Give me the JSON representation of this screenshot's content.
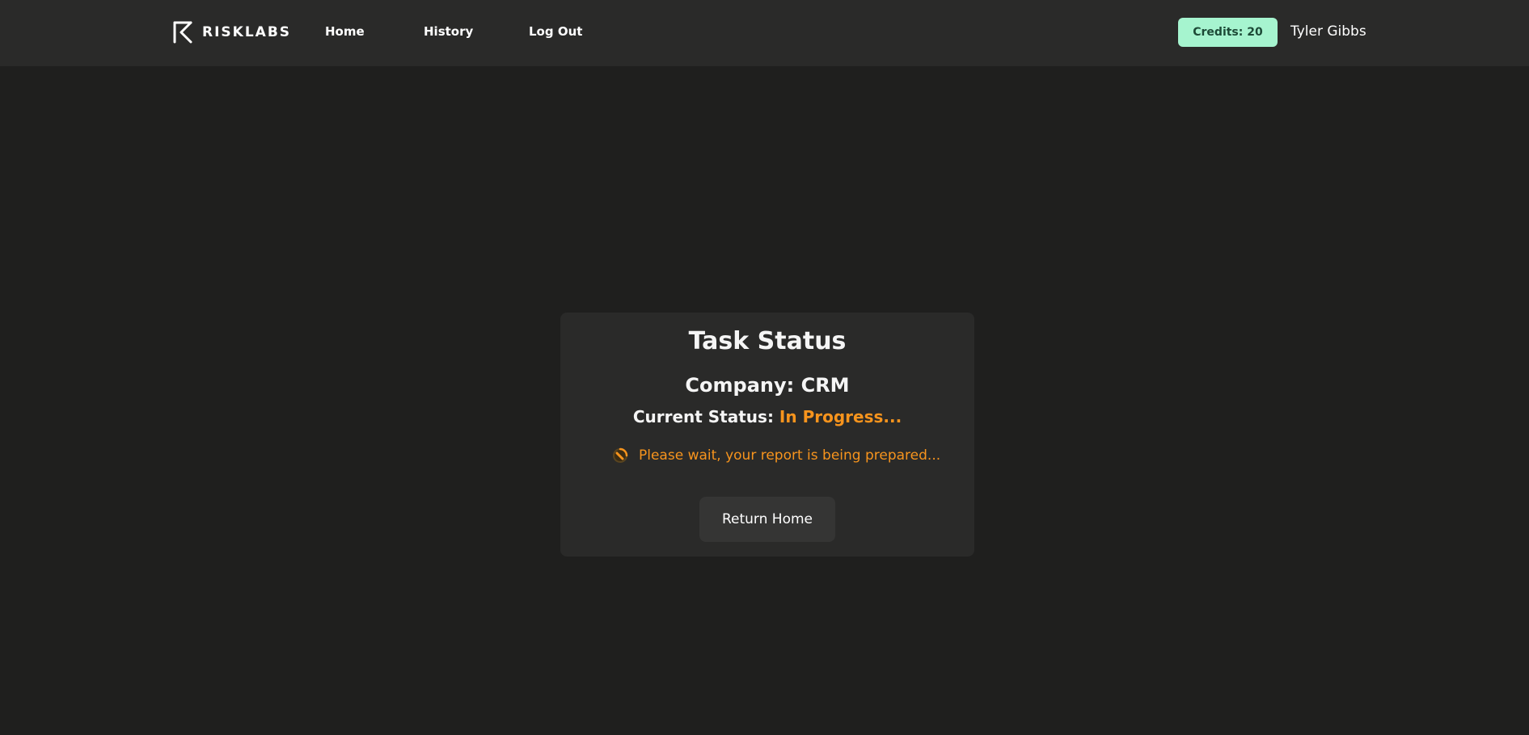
{
  "brand": {
    "logo_icon": "risklabs-logo-icon",
    "name": "RISKLABS"
  },
  "nav": {
    "home": "Home",
    "history": "History",
    "logout": "Log Out"
  },
  "account": {
    "credits_label": "Credits: 20",
    "user_name": "Tyler Gibbs"
  },
  "task": {
    "title": "Task Status",
    "company_line": "Company: CRM",
    "status_label": "Current Status:",
    "status_value": "In Progress...",
    "spinner_icon": "loading-spinner-icon",
    "wait_message": "Please wait, your report is being prepared...",
    "return_button": "Return Home"
  },
  "colors": {
    "background": "#1f1f1e",
    "header": "#2a2a29",
    "card": "#2a2a29",
    "accent_orange": "#f7941d",
    "credits_bg": "#a6f4cf",
    "credits_text": "#1d4a37"
  }
}
